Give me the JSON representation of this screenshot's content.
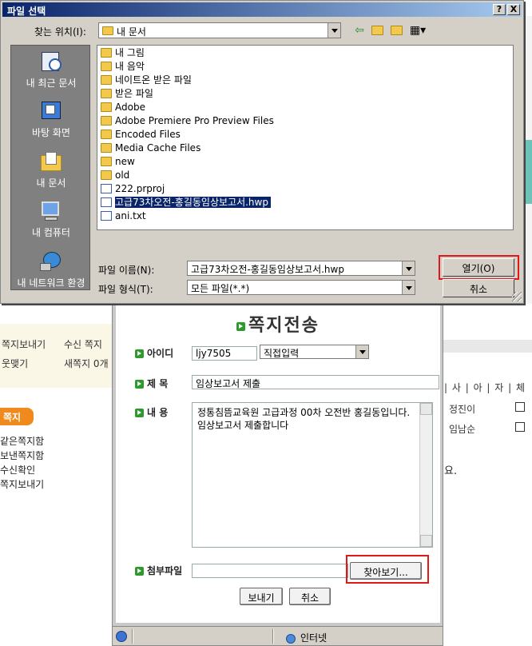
{
  "background_page": {
    "left_menu": [
      "쪽지보내기",
      "수신 쪽지",
      "웃맺기",
      "새쪽지 0개"
    ],
    "tab_label": "쪽지",
    "links": [
      "같은쪽지함",
      "보낸쪽지함",
      "수신확인",
      "쪽지보내기"
    ],
    "table_header": "| 사 | 아 | 자 | 체",
    "names": [
      "정진이",
      "임남순"
    ],
    "note": "요."
  },
  "message_window": {
    "title": "쪽지전송",
    "id_label": "아이디",
    "id_value": "ljy7505",
    "input_mode": "직접입력",
    "subject_label": "제 목",
    "subject_value": "임상보고서 제출",
    "content_label": "내 용",
    "content_value": "정통침뜸교육원 고급과정 00차 오전반 홍길동입니다. 임상보고서 제출합니다",
    "attach_label": "첨부파일",
    "attach_value": "",
    "browse_button": "찾아보기...",
    "send_button": "보내기",
    "cancel_button": "취소",
    "status_zone": "인터넷"
  },
  "file_dialog": {
    "title": "파일 선택",
    "help_button": "?",
    "close_button": "X",
    "look_in_label": "찾는 위치(I):",
    "look_in_value": "내 문서",
    "places": [
      "내 최근 문서",
      "바탕 화면",
      "내 문서",
      "내 컴퓨터",
      "내 네트워크 환경"
    ],
    "files": [
      {
        "name": "내 그림",
        "type": "folder"
      },
      {
        "name": "내 음악",
        "type": "folder"
      },
      {
        "name": "네이트온 받은 파일",
        "type": "folder"
      },
      {
        "name": "받은 파일",
        "type": "folder"
      },
      {
        "name": "Adobe",
        "type": "folder"
      },
      {
        "name": "Adobe Premiere Pro Preview Files",
        "type": "folder"
      },
      {
        "name": "Encoded Files",
        "type": "folder"
      },
      {
        "name": "Media Cache Files",
        "type": "folder"
      },
      {
        "name": "new",
        "type": "folder"
      },
      {
        "name": "old",
        "type": "folder"
      },
      {
        "name": "222.prproj",
        "type": "file"
      },
      {
        "name": "고급73차오전-홍길동임상보고서.hwp",
        "type": "file",
        "selected": true
      },
      {
        "name": "ani.txt",
        "type": "file"
      }
    ],
    "filename_label": "파일 이름(N):",
    "filename_value": "고급73차오전-홍길동임상보고서.hwp",
    "filetype_label": "파일 형식(T):",
    "filetype_value": "모든 파일(*.*)",
    "open_button": "열기(O)",
    "cancel_button": "취소"
  },
  "colors": {
    "title_bar": "#0a246a",
    "highlight": "#e01818",
    "accent_green": "#2e9a2e"
  }
}
